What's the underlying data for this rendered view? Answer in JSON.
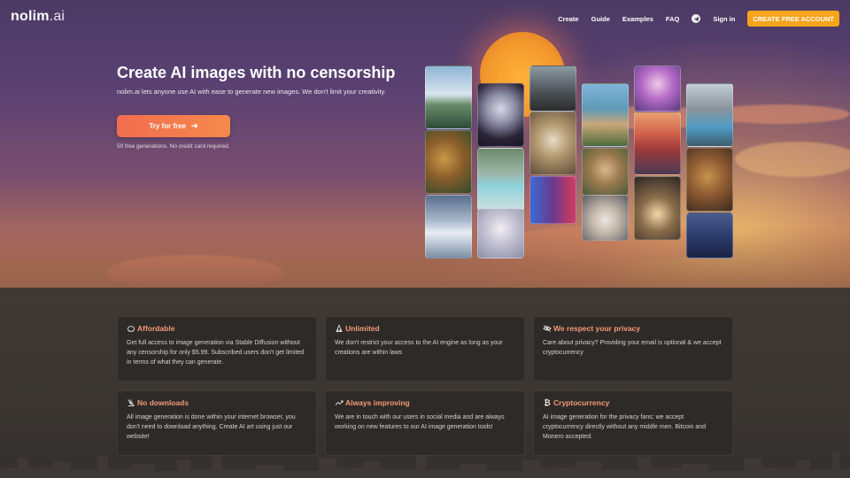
{
  "brand": {
    "logo_main": "nolim",
    "logo_suffix": ".ai"
  },
  "nav": {
    "links": [
      "Create",
      "Guide",
      "Examples",
      "FAQ"
    ],
    "telegram_icon": "telegram-icon",
    "signin": "Sign in",
    "cta": "CREATE FREE ACCOUNT",
    "cta_color": "#f5a41c"
  },
  "hero": {
    "title": "Create AI images with no censorship",
    "subtitle": "nolim.ai lets anyone use AI with ease to generate new images. We don't limit your creativity.",
    "button": "Try for free",
    "button_icon": "arrow-right-icon",
    "note": "50 free generations. No credit card required."
  },
  "gallery": [
    [
      "mountain-lake",
      "monkey-family",
      "snowy-peaks"
    ],
    [
      "cyborg-woman",
      "forest-pool",
      "white-hair-girl"
    ],
    [
      "armored-figure",
      "grand-hall",
      "cyberpunk-man"
    ],
    [
      "coastal-villa",
      "renaissance-portrait",
      "astronaut-dog"
    ],
    [
      "anime-girl",
      "red-mountains",
      "luxury-lobby"
    ],
    [
      "modern-house-pool",
      "monkey-group",
      "neon-city"
    ]
  ],
  "features": [
    {
      "icon": "piggy-bank-icon",
      "title": "Affordable",
      "body": "Get full access to image generation via Stable Diffusion without any censorship for only $5.99. Subscribed users don't get limited in terms of what they can generate."
    },
    {
      "icon": "unlimited-icon",
      "title": "Unlimited",
      "body": "We don't restrict your access to the AI engine as long as your creations are within laws"
    },
    {
      "icon": "eye-slash-icon",
      "title": "We respect your privacy",
      "body": "Care about privacy? Providing your email is optional & we accept cryptocurrency"
    },
    {
      "icon": "no-download-icon",
      "title": "No downloads",
      "body": "All image generation is done within your internet browser, you don't need to download anything. Create AI art using just our website!"
    },
    {
      "icon": "trending-up-icon",
      "title": "Always improving",
      "body": "We are in touch with our users in social media and are always working on new features to our AI image generation tools!"
    },
    {
      "icon": "bitcoin-icon",
      "title": "Cryptocurrency",
      "body": "AI image generation for the privacy fans: we accept cryptocurrency directly without any middle men. Bitcoin and Monero accepted."
    }
  ],
  "colors": {
    "accent_title": "#f39a78",
    "card_bg": "#2e2a27"
  }
}
